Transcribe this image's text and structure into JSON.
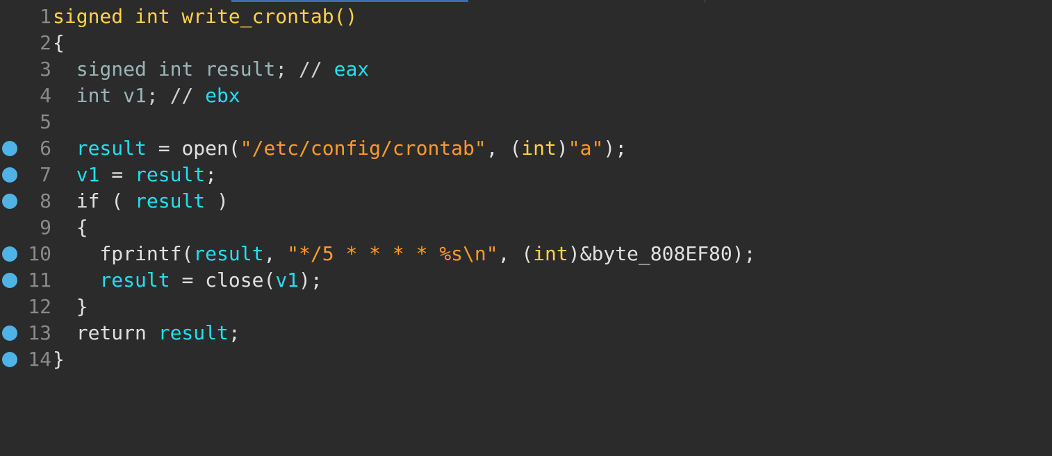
{
  "colors": {
    "background": "#2b2b2b",
    "breakpoint": "#4fb3e8",
    "line_number": "#8a8a8a",
    "function_signature": "#ffd24a",
    "variable": "#20e0f0",
    "string_literal": "#ff9a2a",
    "tab_accent": "#3a6fb0"
  },
  "lines": [
    {
      "num": "1",
      "breakpoint": false,
      "tokens": [
        {
          "t": "signed int write_crontab()",
          "c": "fn"
        }
      ]
    },
    {
      "num": "2",
      "breakpoint": false,
      "tokens": [
        {
          "t": "{",
          "c": "txt"
        }
      ]
    },
    {
      "num": "3",
      "breakpoint": false,
      "tokens": [
        {
          "t": "  signed int result",
          "c": "dim"
        },
        {
          "t": "; // ",
          "c": "cmt"
        },
        {
          "t": "eax",
          "c": "var"
        }
      ]
    },
    {
      "num": "4",
      "breakpoint": false,
      "tokens": [
        {
          "t": "  int v1",
          "c": "dim"
        },
        {
          "t": "; // ",
          "c": "cmt"
        },
        {
          "t": "ebx",
          "c": "var"
        }
      ]
    },
    {
      "num": "5",
      "breakpoint": false,
      "tokens": []
    },
    {
      "num": "6",
      "breakpoint": true,
      "tokens": [
        {
          "t": "  ",
          "c": "txt"
        },
        {
          "t": "result",
          "c": "var"
        },
        {
          "t": " = open(",
          "c": "txt"
        },
        {
          "t": "\"/etc/config/crontab\"",
          "c": "str"
        },
        {
          "t": ", (",
          "c": "txt"
        },
        {
          "t": "int",
          "c": "fn"
        },
        {
          "t": ")",
          "c": "txt"
        },
        {
          "t": "\"a\"",
          "c": "str"
        },
        {
          "t": ");",
          "c": "txt"
        }
      ]
    },
    {
      "num": "7",
      "breakpoint": true,
      "tokens": [
        {
          "t": "  ",
          "c": "txt"
        },
        {
          "t": "v1",
          "c": "var"
        },
        {
          "t": " = ",
          "c": "txt"
        },
        {
          "t": "result",
          "c": "var"
        },
        {
          "t": ";",
          "c": "txt"
        }
      ]
    },
    {
      "num": "8",
      "breakpoint": true,
      "tokens": [
        {
          "t": "  if ( ",
          "c": "txt"
        },
        {
          "t": "result",
          "c": "var"
        },
        {
          "t": " )",
          "c": "txt"
        }
      ]
    },
    {
      "num": "9",
      "breakpoint": false,
      "tokens": [
        {
          "t": "  {",
          "c": "txt"
        }
      ]
    },
    {
      "num": "10",
      "breakpoint": true,
      "tokens": [
        {
          "t": "    fprintf(",
          "c": "txt"
        },
        {
          "t": "result",
          "c": "var"
        },
        {
          "t": ", ",
          "c": "txt"
        },
        {
          "t": "\"*/5 * * * * %s\\n\"",
          "c": "str"
        },
        {
          "t": ", (",
          "c": "txt"
        },
        {
          "t": "int",
          "c": "fn"
        },
        {
          "t": ")&byte_808EF80);",
          "c": "txt"
        }
      ]
    },
    {
      "num": "11",
      "breakpoint": true,
      "tokens": [
        {
          "t": "    ",
          "c": "txt"
        },
        {
          "t": "result",
          "c": "var"
        },
        {
          "t": " = close(",
          "c": "txt"
        },
        {
          "t": "v1",
          "c": "var"
        },
        {
          "t": ");",
          "c": "txt"
        }
      ]
    },
    {
      "num": "12",
      "breakpoint": false,
      "tokens": [
        {
          "t": "  }",
          "c": "txt"
        }
      ]
    },
    {
      "num": "13",
      "breakpoint": true,
      "tokens": [
        {
          "t": "  return ",
          "c": "txt"
        },
        {
          "t": "result",
          "c": "var"
        },
        {
          "t": ";",
          "c": "txt"
        }
      ]
    },
    {
      "num": "14",
      "breakpoint": true,
      "tokens": [
        {
          "t": "}",
          "c": "txt"
        }
      ]
    }
  ]
}
